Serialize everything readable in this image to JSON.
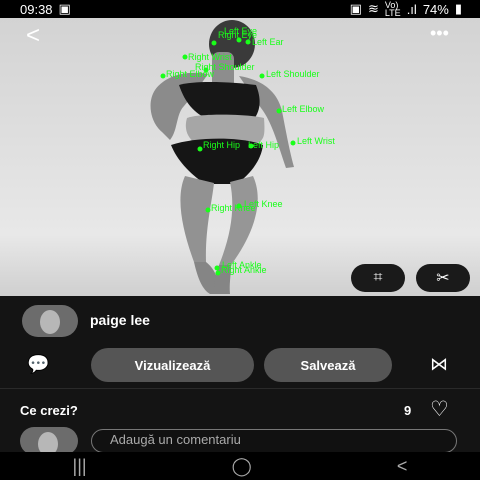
{
  "status_bar": {
    "time": "09:38",
    "signal_text_top": "Vo)",
    "signal_text_bottom": "LTE",
    "battery": "74%"
  },
  "photo": {
    "keypoint_labels": [
      "Right Eye",
      "Left Eye",
      "Left Ear",
      "Right Wrist",
      "Right Shoulder",
      "Left Shoulder",
      "Right Elbow",
      "Left Elbow",
      "Left Wrist",
      "Right Hip",
      "Left Hip",
      "Right Knee",
      "Left Knee",
      "Left Ankle",
      "Right Ankle"
    ]
  },
  "profile": {
    "username": "paige lee"
  },
  "actions": {
    "visualize": "Vizualizează",
    "save": "Salvează"
  },
  "comments": {
    "title": "Ce crezi?",
    "like_count": "9",
    "placeholder": "Adaugă un comentariu"
  },
  "colors": {
    "keypoint": "#19ff19",
    "button": "#555555",
    "background": "#141414"
  }
}
